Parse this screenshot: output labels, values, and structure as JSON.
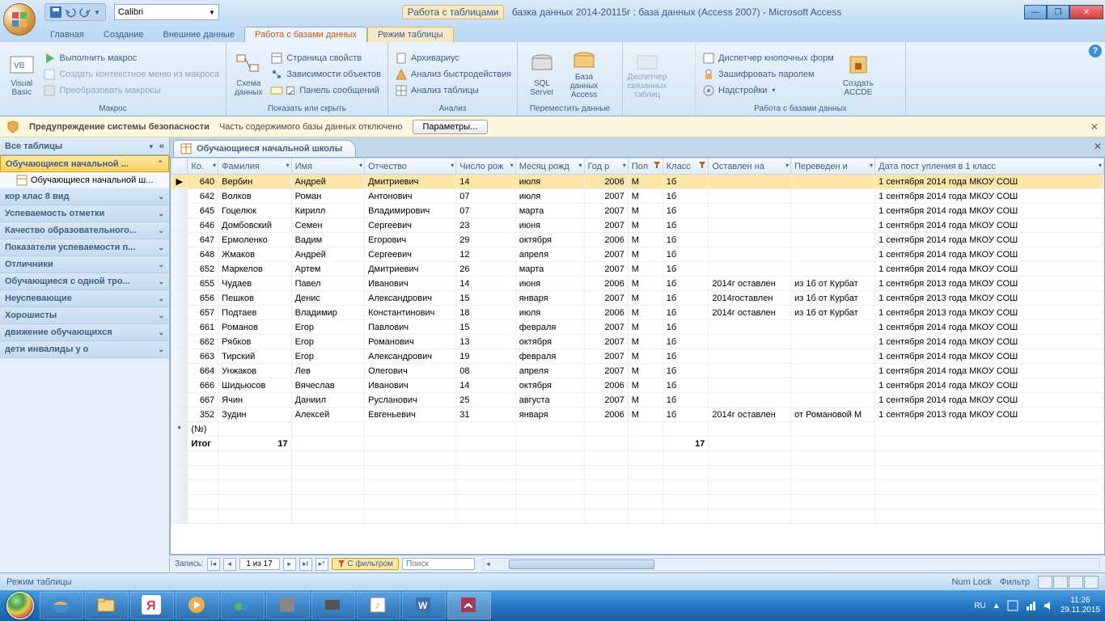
{
  "qat": {
    "font": "Calibri"
  },
  "title": {
    "tools": "Работа с таблицами",
    "file": "базка данных 2014-20115г : база данных (Access 2007) - Microsoft Access"
  },
  "tabs": [
    "Главная",
    "Создание",
    "Внешние данные",
    "Работа с базами данных",
    "Режим таблицы"
  ],
  "active_tab": 3,
  "ribbon": {
    "g1": {
      "label": "Макрос",
      "big": "Visual\nBasic",
      "items": [
        "Выполнить макрос",
        "Создать контекстное меню из макроса",
        "Преобразовать макросы"
      ]
    },
    "g2": {
      "label": "Показать или скрыть",
      "big": "Схема\nданных",
      "items": [
        "Страница свойств",
        "Зависимости объектов",
        "Панель сообщений"
      ]
    },
    "g3": {
      "label": "Анализ",
      "items": [
        "Архивариус",
        "Анализ быстродействия",
        "Анализ таблицы"
      ]
    },
    "g4": {
      "label": "Переместить данные",
      "b1": "SQL\nServer",
      "b2": "База данных\nAccess"
    },
    "g5": {
      "label": "",
      "big": "Диспетчер\nсвязанных таблиц"
    },
    "g6": {
      "label": "Работа с базами данных",
      "items": [
        "Диспетчер кнопочных форм",
        "Зашифровать паролем",
        "Надстройки"
      ],
      "big": "Создать\nACCDE"
    }
  },
  "security": {
    "title": "Предупреждение системы безопасности",
    "msg": "Часть содержимого базы данных отключено",
    "btn": "Параметры..."
  },
  "nav": {
    "header": "Все таблицы",
    "groups": [
      {
        "label": "Обучающиеся начальной ...",
        "sel": true,
        "items": [
          "Обучающиеся начальной ш..."
        ]
      },
      {
        "label": "кор клас 8 вид"
      },
      {
        "label": "Успеваемость отметки"
      },
      {
        "label": "Качество образовательного..."
      },
      {
        "label": "Показатели успеваемости п..."
      },
      {
        "label": "Отличники"
      },
      {
        "label": "Обучающиеся с одной тро..."
      },
      {
        "label": "Неуспевающие"
      },
      {
        "label": "Хорошисты"
      },
      {
        "label": "движение обучающихся"
      },
      {
        "label": "дети инвалиды у о"
      }
    ]
  },
  "doc_tab": "Обучающиеся начальной школы",
  "columns": [
    "Ко.",
    "Фамилия",
    "Имя",
    "Отчество",
    "Число рож",
    "Месяц рожд",
    "Год р",
    "Пол",
    "Класс",
    "Оставлен на",
    "Переведен и",
    "Дата пост упления в 1 класс"
  ],
  "col_filtered": [
    false,
    false,
    false,
    false,
    false,
    false,
    false,
    true,
    true,
    false,
    false,
    false
  ],
  "rows": [
    {
      "k": "640",
      "f": "Вербин",
      "i": "Андрей",
      "o": "Дмитриевич",
      "d": "14",
      "m": "июля",
      "y": "2006",
      "p": "М",
      "c": "1б",
      "ost": "",
      "per": "",
      "dt": "1 сентября 2014 года МКОУ СОШ",
      "sel": true
    },
    {
      "k": "642",
      "f": "Волков",
      "i": "Роман",
      "o": "Антонович",
      "d": "07",
      "m": "июля",
      "y": "2007",
      "p": "М",
      "c": "1б",
      "ost": "",
      "per": "",
      "dt": "1 сентября 2014 года МКОУ СОШ"
    },
    {
      "k": "645",
      "f": "Гоцелюк",
      "i": "Кирилл",
      "o": "Владимирович",
      "d": "07",
      "m": "марта",
      "y": "2007",
      "p": "М",
      "c": "1б",
      "ost": "",
      "per": "",
      "dt": "1 сентября 2014 года МКОУ СОШ"
    },
    {
      "k": "646",
      "f": "Домбовский",
      "i": "Семен",
      "o": "Сергеевич",
      "d": "23",
      "m": "июня",
      "y": "2007",
      "p": "М",
      "c": "1б",
      "ost": "",
      "per": "",
      "dt": "1 сентября 2014 года МКОУ СОШ"
    },
    {
      "k": "647",
      "f": "Ермоленко",
      "i": "Вадим",
      "o": "Егорович",
      "d": "29",
      "m": "октября",
      "y": "2006",
      "p": "М",
      "c": "1б",
      "ost": "",
      "per": "",
      "dt": "1 сентября 2014 года МКОУ СОШ"
    },
    {
      "k": "648",
      "f": "Жмаков",
      "i": "Андрей",
      "o": "Сергеевич",
      "d": "12",
      "m": "апреля",
      "y": "2007",
      "p": "М",
      "c": "1б",
      "ost": "",
      "per": "",
      "dt": "1 сентября 2014 года МКОУ СОШ"
    },
    {
      "k": "652",
      "f": "Маркелов",
      "i": "Артем",
      "o": "Дмитриевич",
      "d": "26",
      "m": "марта",
      "y": "2007",
      "p": "М",
      "c": "1б",
      "ost": "",
      "per": "",
      "dt": "1 сентября 2014 года МКОУ СОШ"
    },
    {
      "k": "655",
      "f": "Чудаев",
      "i": "Павел",
      "o": "Иванович",
      "d": "14",
      "m": "июня",
      "y": "2006",
      "p": "М",
      "c": "1б",
      "ost": "2014г оставлен",
      "per": "из 1б от Курбат",
      "dt": "1 сентября 2013 года МКОУ СОШ"
    },
    {
      "k": "656",
      "f": "Пешков",
      "i": "Денис",
      "o": "Александрович",
      "d": "15",
      "m": "января",
      "y": "2007",
      "p": "М",
      "c": "1б",
      "ost": "2014гоставлен",
      "per": "из 1б от Курбат",
      "dt": "1 сентября 2013 года МКОУ СОШ"
    },
    {
      "k": "657",
      "f": "Подтаев",
      "i": "Владимир",
      "o": "Константинович",
      "d": "18",
      "m": "июля",
      "y": "2006",
      "p": "М",
      "c": "1б",
      "ost": "2014г оставлен",
      "per": "из 1б от Курбат",
      "dt": "1 сентября 2013 года МКОУ СОШ"
    },
    {
      "k": "661",
      "f": "Романов",
      "i": "Егор",
      "o": "Павлович",
      "d": "15",
      "m": "февраля",
      "y": "2007",
      "p": "М",
      "c": "1б",
      "ost": "",
      "per": "",
      "dt": "1 сентября 2014 года МКОУ СОШ"
    },
    {
      "k": "662",
      "f": "Рябков",
      "i": "Егор",
      "o": "Романович",
      "d": "13",
      "m": "октября",
      "y": "2007",
      "p": "М",
      "c": "1б",
      "ost": "",
      "per": "",
      "dt": "1 сентября 2014 года МКОУ СОШ"
    },
    {
      "k": "663",
      "f": "Тирский",
      "i": "Егор",
      "o": "Александрович",
      "d": "19",
      "m": "февраля",
      "y": "2007",
      "p": "М",
      "c": "1б",
      "ost": "",
      "per": "",
      "dt": "1 сентября 2014 года МКОУ СОШ"
    },
    {
      "k": "664",
      "f": "Унжаков",
      "i": "Лев",
      "o": "Олегович",
      "d": "08",
      "m": "апреля",
      "y": "2007",
      "p": "М",
      "c": "1б",
      "ost": "",
      "per": "",
      "dt": "1 сентября 2014 года МКОУ СОШ"
    },
    {
      "k": "666",
      "f": "Шидьюсов",
      "i": "Вячеслав",
      "o": "Иванович",
      "d": "14",
      "m": "октября",
      "y": "2006",
      "p": "М",
      "c": "1б",
      "ost": "",
      "per": "",
      "dt": "1 сентября 2014 года МКОУ СОШ"
    },
    {
      "k": "667",
      "f": "Ячин",
      "i": "Даниил",
      "o": "Русланович",
      "d": "25",
      "m": "августа",
      "y": "2007",
      "p": "М",
      "c": "1б",
      "ost": "",
      "per": "",
      "dt": "1 сентября 2014 года МКОУ СОШ"
    },
    {
      "k": "352",
      "f": "Зудин",
      "i": "Алексей",
      "o": "Евгеньевич",
      "d": "31",
      "m": "января",
      "y": "2006",
      "p": "М",
      "c": "1б",
      "ost": "2014г оставлен",
      "per": "от Романовой М",
      "dt": "1 сентября 2013 года МКОУ СОШ"
    }
  ],
  "newrow": "(№)",
  "totals": {
    "label": "Итог",
    "count": "17",
    "class_count": "17"
  },
  "recnav": {
    "label": "Запись:",
    "pos": "1 из 17",
    "filter": "С фильтром",
    "search": "Поиск"
  },
  "status": {
    "mode": "Режим таблицы",
    "numlock": "Num Lock",
    "filter": "Фильтр"
  },
  "tray": {
    "lang": "RU",
    "time": "11:26",
    "date": "29.11.2015"
  }
}
